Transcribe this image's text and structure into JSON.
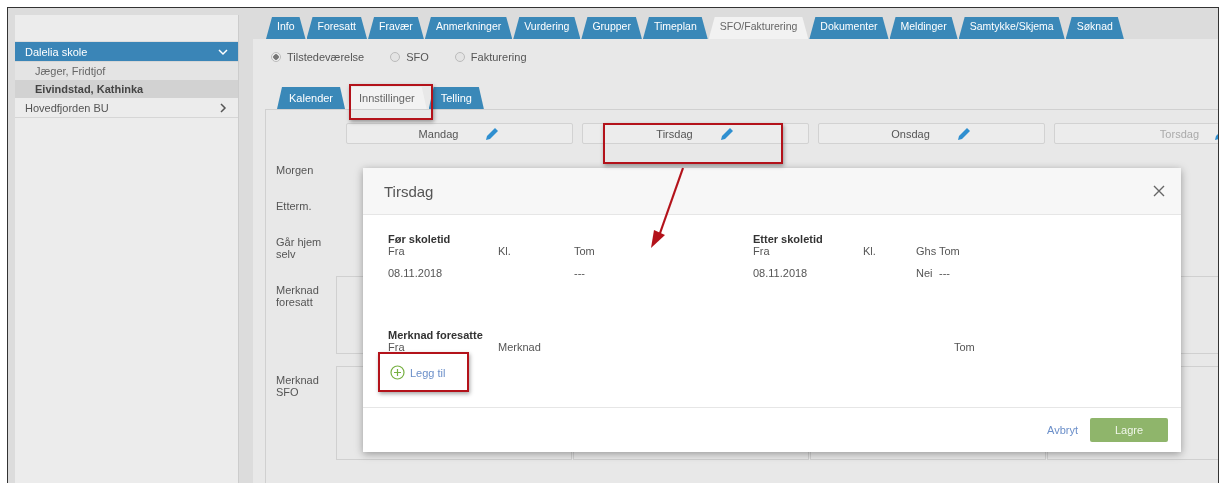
{
  "sidebar": {
    "groups": [
      {
        "label": "Dalelia skole",
        "expanded": true,
        "selected": true,
        "children": [
          {
            "label": "Jæger, Fridtjof",
            "selected": false
          },
          {
            "label": "Eivindstad, Kathinka",
            "selected": true
          }
        ]
      },
      {
        "label": "Hovedfjorden BU",
        "expanded": false,
        "selected": false
      }
    ]
  },
  "tabs": [
    {
      "label": "Info",
      "selected": false
    },
    {
      "label": "Foresatt",
      "selected": false
    },
    {
      "label": "Fravær",
      "selected": false
    },
    {
      "label": "Anmerkninger",
      "selected": false
    },
    {
      "label": "Vurdering",
      "selected": false
    },
    {
      "label": "Grupper",
      "selected": false
    },
    {
      "label": "Timeplan",
      "selected": false
    },
    {
      "label": "SFO/Fakturering",
      "selected": true
    },
    {
      "label": "Dokumenter",
      "selected": false
    },
    {
      "label": "Meldinger",
      "selected": false
    },
    {
      "label": "Samtykke/Skjema",
      "selected": false
    },
    {
      "label": "Søknad",
      "selected": false
    }
  ],
  "radios": [
    {
      "label": "Tilstedeværelse",
      "selected": true
    },
    {
      "label": "SFO",
      "selected": false
    },
    {
      "label": "Fakturering",
      "selected": false
    }
  ],
  "subtabs": [
    {
      "label": "Kalender",
      "selected": false
    },
    {
      "label": "Innstillinger",
      "selected": true
    },
    {
      "label": "Telling",
      "selected": false
    }
  ],
  "days": [
    {
      "label": "Mandag",
      "disabled": false
    },
    {
      "label": "Tirsdag",
      "disabled": false
    },
    {
      "label": "Onsdag",
      "disabled": false
    },
    {
      "label": "Torsdag",
      "disabled": true
    }
  ],
  "row_labels": [
    "Morgen",
    "Etterm.",
    "Går hjem selv",
    "Merknad foresatt",
    "Merknad SFO"
  ],
  "dialog": {
    "title": "Tirsdag",
    "sections": [
      {
        "title": "Før skoletid",
        "columns": [
          "Fra",
          "Kl.",
          "",
          "Tom"
        ],
        "rows": [
          [
            "08.11.2018",
            "",
            "",
            "---"
          ]
        ]
      },
      {
        "title": "Etter skoletid",
        "columns": [
          "Fra",
          "Kl.",
          "Ghs",
          "Tom"
        ],
        "rows": [
          [
            "08.11.2018",
            "",
            "Nei",
            "---"
          ]
        ]
      }
    ],
    "notes": {
      "title": "Merknad foresatte",
      "columns": [
        "Fra",
        "Merknad",
        "Tom"
      ],
      "add_label": "Legg til"
    },
    "cancel": "Avbryt",
    "save": "Lagre"
  }
}
